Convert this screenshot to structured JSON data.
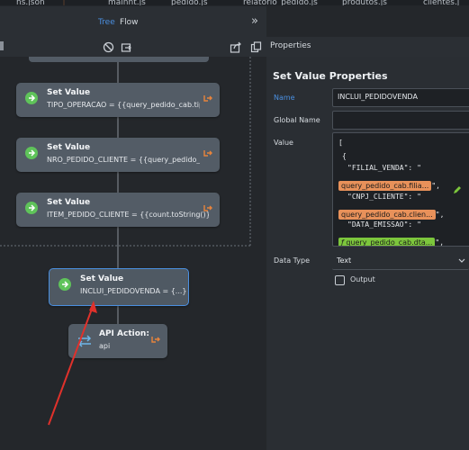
{
  "tabs": [
    {
      "label": "ns.json"
    },
    {
      "label": "mainnt.js"
    },
    {
      "label": "pedido.js"
    },
    {
      "label": "relatorio_pedido.js"
    },
    {
      "label": "produtos.js"
    },
    {
      "label": "clientes.j"
    }
  ],
  "header": {
    "tab_tree": "Tree",
    "tab_flow": "Flow",
    "collapse_glyph": "»"
  },
  "properties_panel": {
    "header": "Properties",
    "title": "Set Value Properties",
    "name_label": "Name",
    "name_value": "INCLUI_PEDIDOVENDA",
    "global_name_label": "Global Name",
    "global_name_value": "",
    "value_label": "Value",
    "value_lines": {
      "open_bracket": "[",
      "open_brace": "{",
      "key1": "\"FILIAL_VENDA\": \"",
      "pill1": "query_pedido_cab.filia...",
      "key2": "\"CNPJ_CLIENTE\": \"",
      "pill2": "query_pedido_cab.clien...",
      "key3": "\"DATA_EMISSAO\": \"",
      "pill3": "query_pedido_cab.dta...",
      "tail": "\","
    },
    "data_type_label": "Data Type",
    "data_type_value": "Text",
    "output_label": "Output",
    "output_checked": false
  },
  "nodes": [
    {
      "title": "Set Value",
      "sub": "TIPO_OPERACAO = {{query_pedido_cab.tip..."
    },
    {
      "title": "Set Value",
      "sub": "NRO_PEDIDO_CLIENTE = {{query_pedido_c..."
    },
    {
      "title": "Set Value",
      "sub": "ITEM_PEDIDO_CLIENTE = {{count.toString()}}"
    },
    {
      "title": "Set Value",
      "sub": "INCLUI_PEDIDOVENDA = {...}"
    },
    {
      "title": "API Action:",
      "sub": "api"
    }
  ],
  "colors": {
    "accent_blue": "#4a8fe0",
    "node_green": "#5fc35a",
    "exit_orange": "#e8843c",
    "pill_orange": "#e8915a",
    "pill_green": "#7cc63c",
    "annotation_red": "#e0312b"
  }
}
